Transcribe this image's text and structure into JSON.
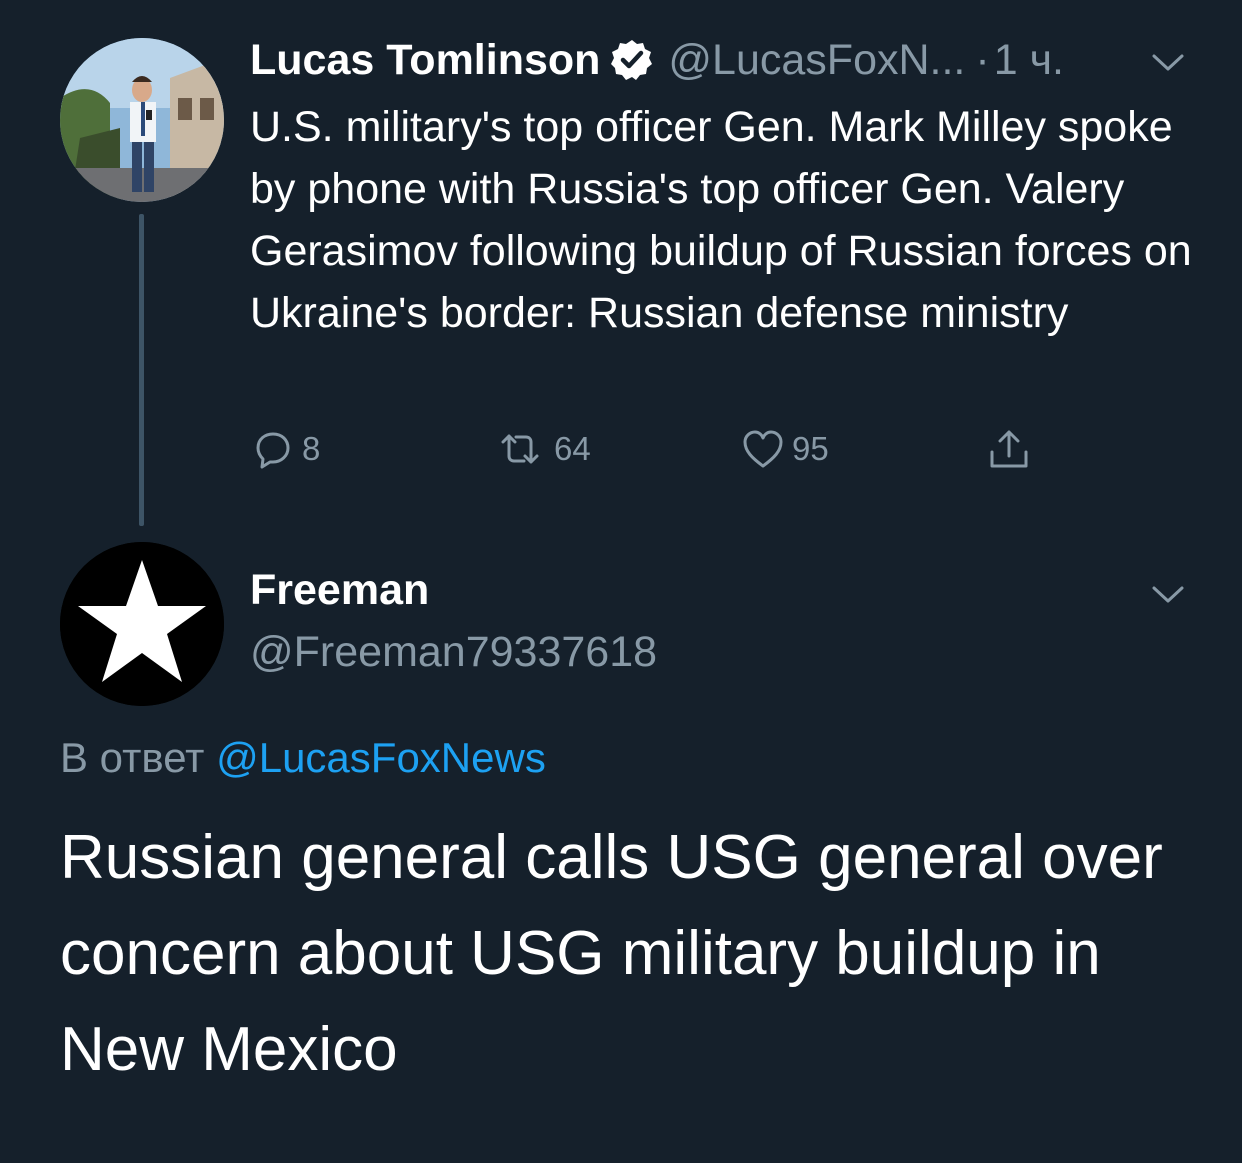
{
  "parent_tweet": {
    "author_name": "Lucas Tomlinson",
    "author_handle": "@LucasFoxN...",
    "separator": "·",
    "time": "1 ч.",
    "text": "U.S. military's top officer Gen. Mark Milley spoke by phone with Russia's top officer Gen. Valery Gerasimov following buildup of Russian forces on Ukraine's border: Russian defense ministry",
    "actions": {
      "replies": "8",
      "retweets": "64",
      "likes": "95"
    },
    "icons": [
      "verified-badge-icon",
      "chevron-down-icon",
      "reply-icon",
      "retweet-icon",
      "like-icon",
      "share-icon"
    ]
  },
  "reply_tweet": {
    "author_name": "Freeman",
    "author_handle": "@Freeman79337618",
    "reply_prefix": "В ответ",
    "reply_mention": "@LucasFoxNews",
    "text": "Russian general calls USG general over concern about USG military buildup in New Mexico",
    "avatar_icon": "star-icon"
  },
  "colors": {
    "background": "#15202b",
    "text_primary": "#ffffff",
    "text_secondary": "#8899a6",
    "accent": "#1da1f2",
    "thread_line": "#3d5466"
  }
}
